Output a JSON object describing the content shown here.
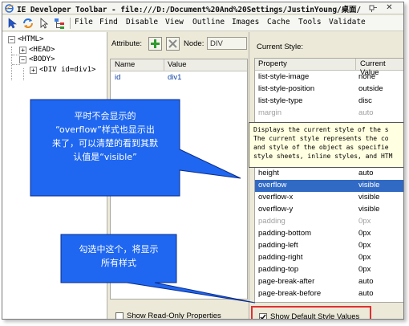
{
  "window": {
    "title": "IE Developer Toolbar - file:///D:/Document%20And%20Settings/JustinYoung/桌面/"
  },
  "menubar": {
    "items": [
      "File",
      "Find",
      "Disable",
      "View",
      "Outline",
      "Images",
      "Cache",
      "Tools",
      "Validate"
    ]
  },
  "tree": {
    "nodes": [
      {
        "expander": "−",
        "label": "<HTML>"
      },
      {
        "expander": "+",
        "label": "<HEAD>"
      },
      {
        "expander": "−",
        "label": "<BODY>"
      },
      {
        "expander": "+",
        "label": "<DIV id=div1>"
      }
    ]
  },
  "attributes": {
    "label": "Attribute:",
    "node_label": "Node:",
    "node_value": "DIV",
    "columns": [
      "Name",
      "Value"
    ],
    "rows": [
      {
        "name": "id",
        "value": "div1"
      }
    ],
    "show_readonly_label": "Show Read-Only Properties"
  },
  "current_style": {
    "label": "Current Style:",
    "columns": [
      "Property",
      "Current Value"
    ],
    "rows": [
      {
        "name": "list-style-image",
        "value": "none",
        "state": "normal"
      },
      {
        "name": "list-style-position",
        "value": "outside",
        "state": "normal"
      },
      {
        "name": "list-style-type",
        "value": "disc",
        "state": "normal"
      },
      {
        "name": "margin",
        "value": "auto",
        "state": "gray"
      },
      {
        "name": "",
        "value": "",
        "state": "normal"
      },
      {
        "name": "",
        "value": "",
        "state": "normal"
      },
      {
        "name": "",
        "value": "",
        "state": "normal"
      },
      {
        "name": "",
        "value": "",
        "state": "normal"
      },
      {
        "name": "height",
        "value": "auto",
        "state": "normal"
      },
      {
        "name": "overflow",
        "value": "visible",
        "state": "selected"
      },
      {
        "name": "overflow-x",
        "value": "visible",
        "state": "normal"
      },
      {
        "name": "overflow-y",
        "value": "visible",
        "state": "normal"
      },
      {
        "name": "padding",
        "value": "0px",
        "state": "gray"
      },
      {
        "name": "padding-bottom",
        "value": "0px",
        "state": "normal"
      },
      {
        "name": "padding-left",
        "value": "0px",
        "state": "normal"
      },
      {
        "name": "padding-right",
        "value": "0px",
        "state": "normal"
      },
      {
        "name": "padding-top",
        "value": "0px",
        "state": "normal"
      },
      {
        "name": "page-break-after",
        "value": "auto",
        "state": "normal"
      },
      {
        "name": "page-break-before",
        "value": "auto",
        "state": "normal"
      }
    ],
    "show_default_label": "Show Default Style Values",
    "show_default_checked": true
  },
  "tooltip": {
    "lines": [
      "Displays the current style of the s",
      "The current style represents the co",
      "and style of the object as specifie",
      "style sheets, inline styles, and HTM"
    ]
  },
  "annotations": {
    "overflow_note": [
      "平时不会显示的",
      "“overflow”样式也显示出",
      "来了，可以清楚的看到其默",
      "认值是“visible”"
    ],
    "checkbox_note": [
      "勾选中这个，将显示",
      "所有样式"
    ]
  },
  "colors": {
    "callout_fill": "#1f67f0",
    "selection": "#316ac5",
    "highlight_box": "#e03030",
    "add_icon": "#2f9a2f"
  }
}
